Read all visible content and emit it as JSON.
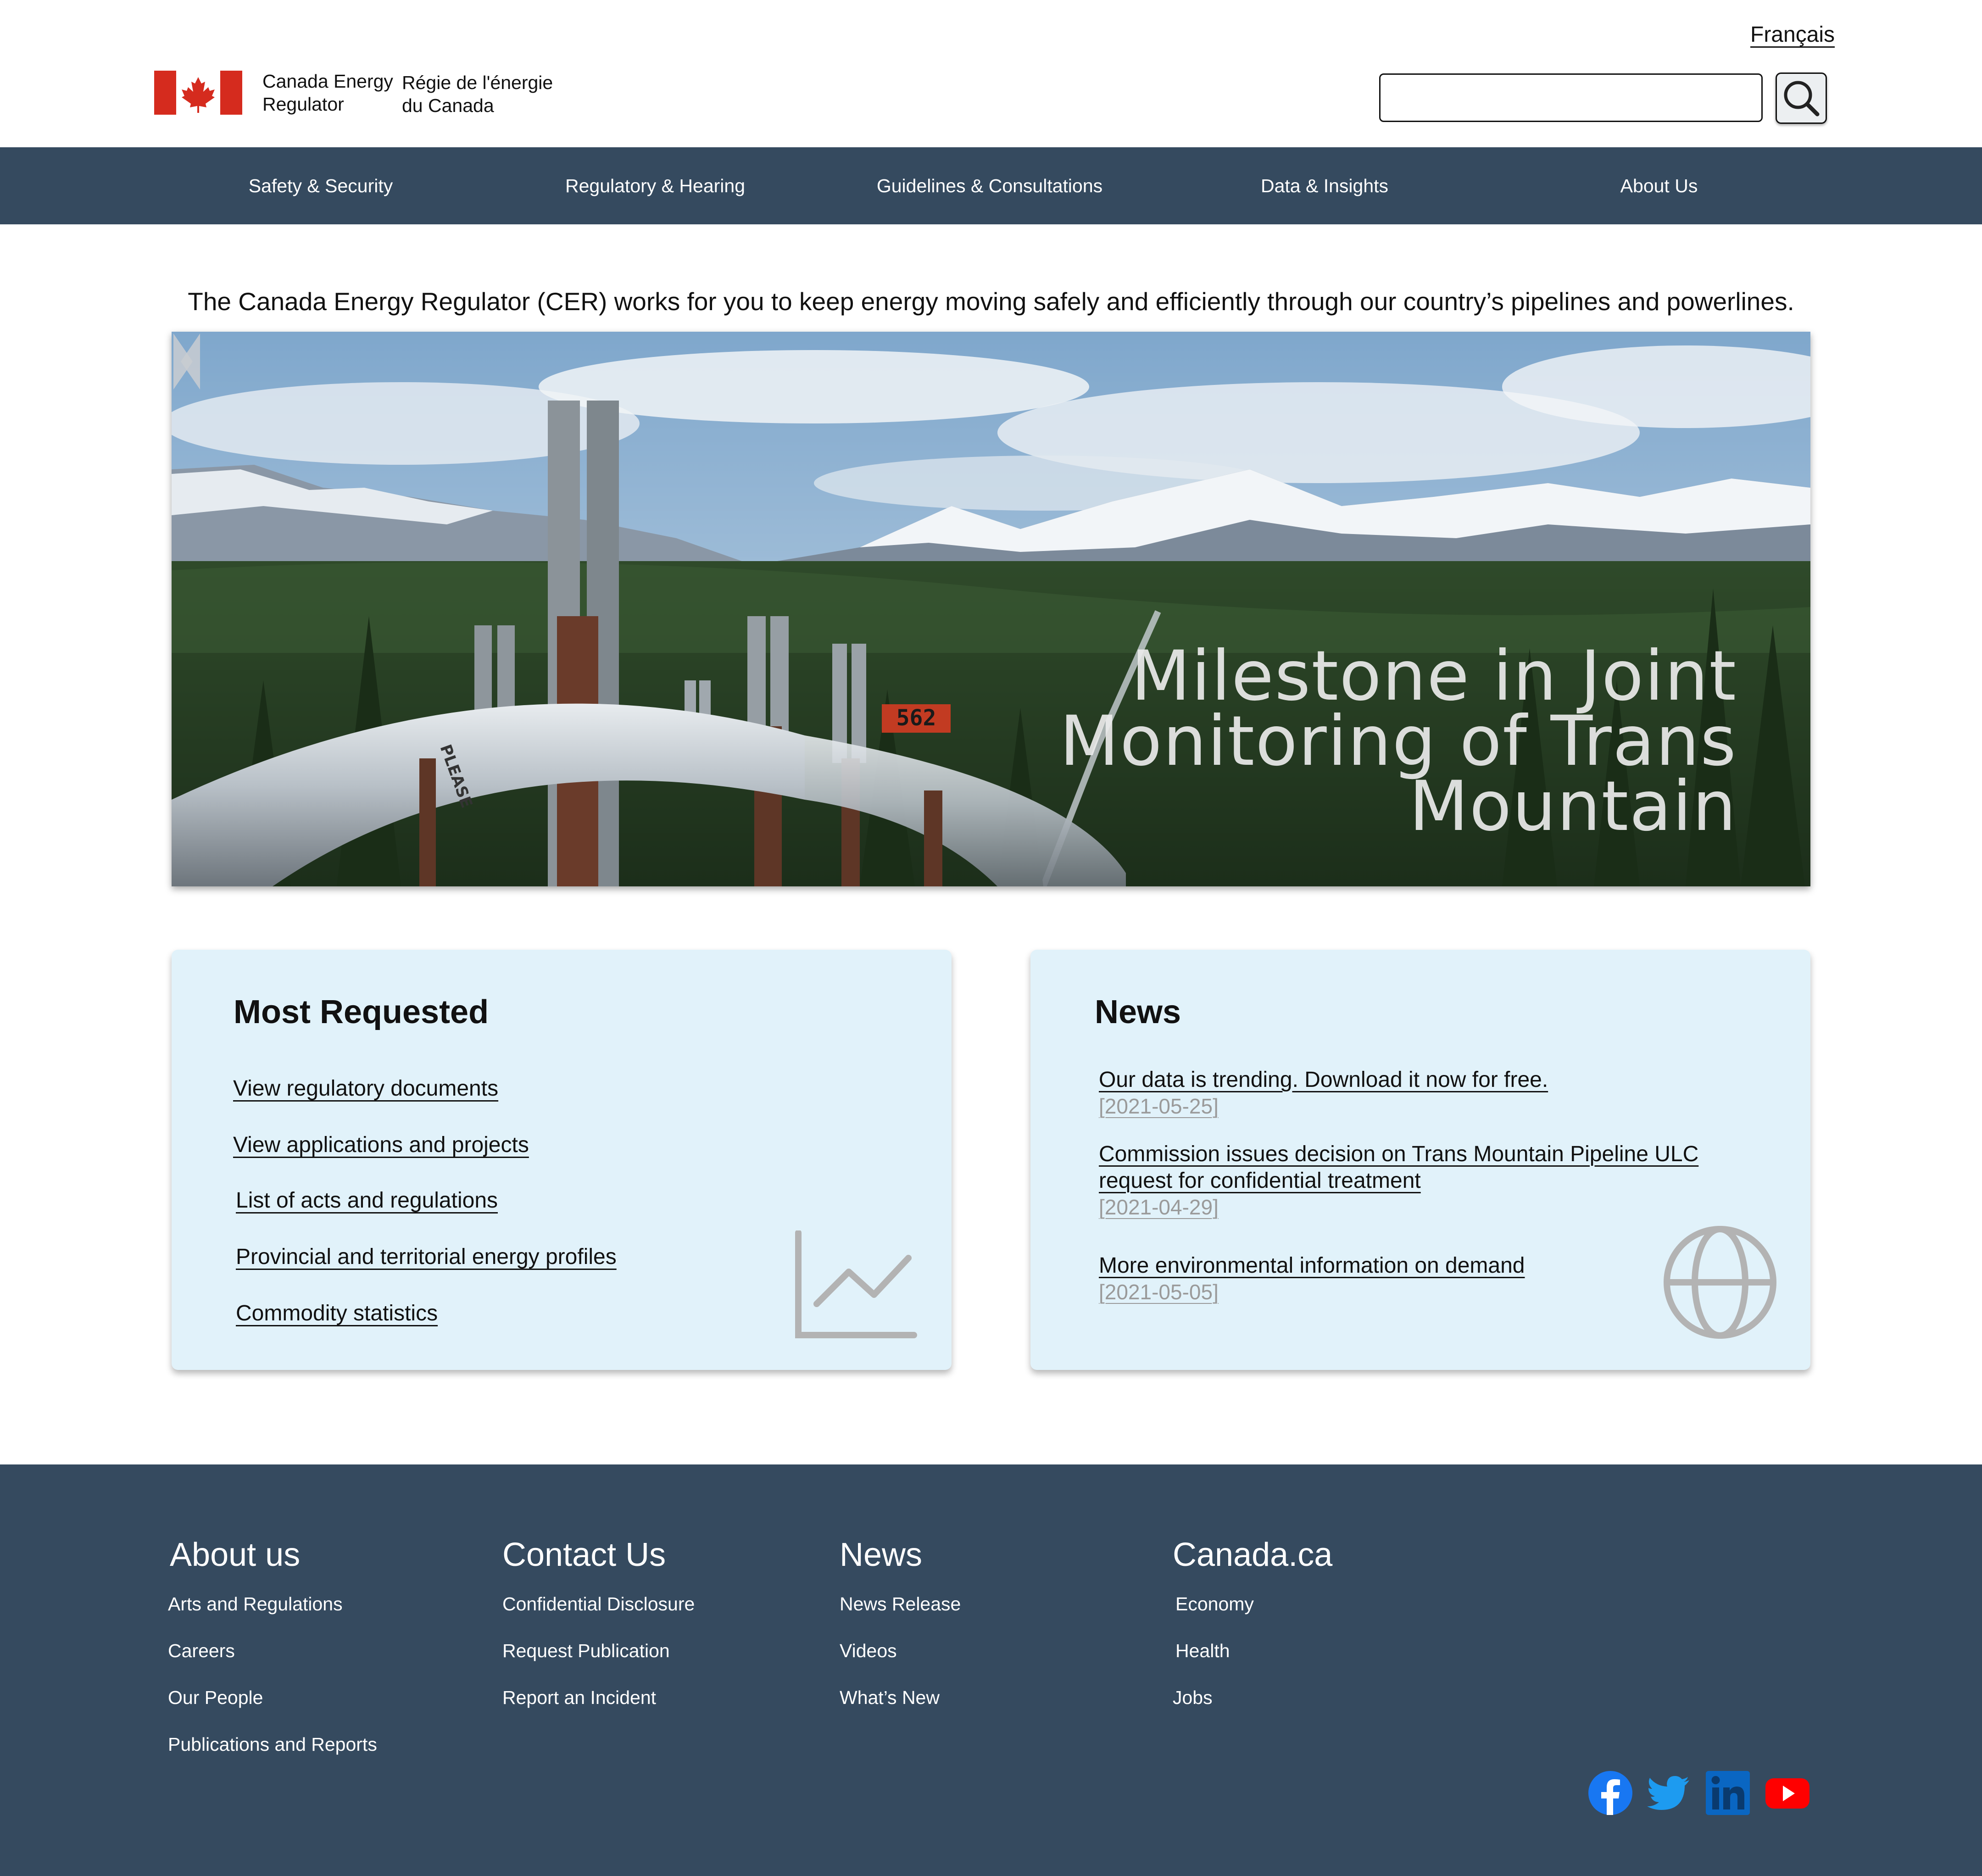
{
  "header": {
    "language_link": "Français",
    "brand_en": "Canada Energy Regulator",
    "brand_fr": "Régie de l'énergie du Canada",
    "search_placeholder": "",
    "search_icon": "magnifier-icon"
  },
  "nav": {
    "items": [
      {
        "label": "Safety & Security"
      },
      {
        "label": "Regulatory & Hearing"
      },
      {
        "label": "Guidelines & Consultations"
      },
      {
        "label": "Data & Insights"
      },
      {
        "label": "About Us"
      }
    ]
  },
  "intro": "The Canada Energy Regulator (CER) works for you to keep energy moving safely and efficiently through our country’s pipelines and powerlines.",
  "hero": {
    "title": "Milestone in Joint Monitoring of Trans Mountain",
    "pipe_marker": "562",
    "pipe_sign": "PLEASE"
  },
  "most_requested": {
    "title": "Most Requested",
    "links": [
      "View regulatory documents",
      "View applications and projects",
      "List of acts and regulations",
      "Provincial and territorial energy profiles",
      "Commodity statistics"
    ],
    "icon": "line-chart-icon"
  },
  "news": {
    "title": "News",
    "items": [
      {
        "title": "Our data is trending. Download it now for free.",
        "date": "[2021-05-25]"
      },
      {
        "title": "Commission issues decision on Trans Mountain Pipeline ULC request for confidential treatment",
        "date": "[2021-04-29]"
      },
      {
        "title": "More environmental information on demand",
        "date": "[2021-05-05]"
      }
    ],
    "icon": "globe-icon"
  },
  "footer": {
    "columns": [
      {
        "heading": "About us",
        "links": [
          "Arts and Regulations",
          "Careers",
          "Our People",
          "Publications and Reports"
        ]
      },
      {
        "heading": "Contact Us",
        "links": [
          "Confidential Disclosure",
          "Request Publication",
          "Report an Incident"
        ]
      },
      {
        "heading": "News",
        "links": [
          "News Release",
          "Videos",
          "What’s New"
        ]
      },
      {
        "heading": "Canada.ca",
        "links": [
          "Economy",
          "Health",
          "Jobs"
        ]
      }
    ],
    "social": [
      "facebook-icon",
      "twitter-icon",
      "linkedin-icon",
      "youtube-icon"
    ]
  },
  "colors": {
    "nav_bg": "#354a5f",
    "card_bg": "#e1f2fa",
    "flag_red": "#d52b1e",
    "facebook": "#1877f2",
    "twitter": "#1d9bf0",
    "linkedin": "#0a66c2",
    "youtube": "#ff0000"
  }
}
